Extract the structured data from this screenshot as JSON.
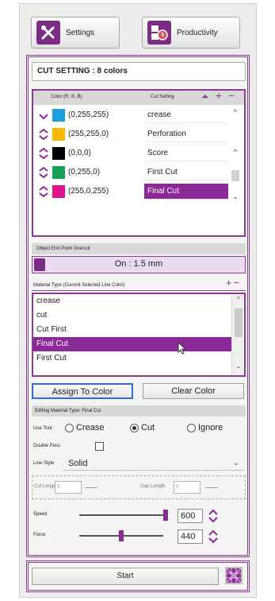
{
  "toolbar": {
    "settings_label": "Settings",
    "productivity_label": "Productivity"
  },
  "cut_setting": {
    "title": "CUT SETTING : 8 colors",
    "header_color": "Color (R, G, B)",
    "header_cut": "Cut Setting",
    "rows": [
      {
        "rgb": "(0,255,255)",
        "setting": "crease",
        "swatch": "#1aa0dc"
      },
      {
        "rgb": "(255,255,0)",
        "setting": "Perforation",
        "swatch": "#f6b800"
      },
      {
        "rgb": "(0,0,0)",
        "setting": "Score",
        "swatch": "#000000"
      },
      {
        "rgb": "(0,255,0)",
        "setting": "First Cut",
        "swatch": "#16a05a"
      },
      {
        "rgb": "(255,0,255)",
        "setting": "Final Cut",
        "swatch": "#e0138a"
      }
    ]
  },
  "overcut": {
    "label": "Object End Point Overcut",
    "value": "On : 1.5 mm"
  },
  "material": {
    "label": "Material Type (Current Selected Line Color)",
    "items": [
      "crease",
      "cut",
      "Cut First",
      "Final Cut",
      "First Cut"
    ]
  },
  "buttons": {
    "assign": "Assign To Color",
    "clear": "Clear Color"
  },
  "editing": {
    "label": "Editing Material Type: Final Cut",
    "use_tool": "Use Tool:",
    "opt_crease": "Crease",
    "opt_cut": "Cut",
    "opt_ignore": "Ignore",
    "double_pass": "Double Pass",
    "line_style": "Line Style",
    "line_style_value": "Solid",
    "cut_length_label": "Cut Length",
    "cut_length_value": "0",
    "gap_length_label": "Gap Length",
    "gap_length_value": "0",
    "speed_label": "Speed",
    "speed_value": "600",
    "force_label": "Force",
    "force_value": "440"
  },
  "footer": {
    "start": "Start"
  },
  "colors": {
    "accent": "#8a2a96"
  }
}
